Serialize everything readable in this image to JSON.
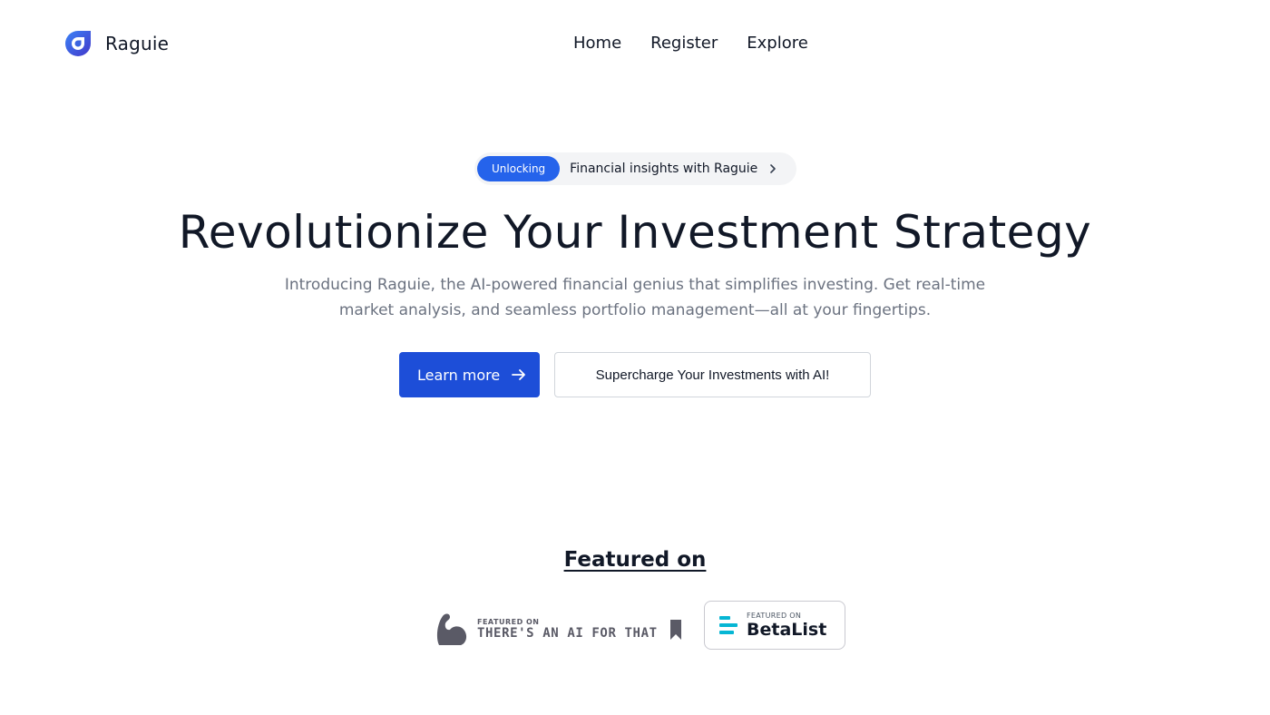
{
  "brand": {
    "name": "Raguie",
    "icon": "raguie-drop-logo",
    "color": "#2563eb"
  },
  "nav": {
    "items": [
      "Home",
      "Register",
      "Explore"
    ]
  },
  "announcement": {
    "badge": "Unlocking",
    "text": "Financial insights with Raguie",
    "icon": "chevron-right-icon"
  },
  "hero": {
    "title": "Revolutionize Your Investment Strategy",
    "subtitle": "Introducing Raguie, the AI-powered financial genius that simplifies investing. Get real-time market analysis, and seamless portfolio management—all at your fingertips.",
    "primary_button": "Learn more",
    "primary_icon": "arrow-right-icon",
    "secondary_button": "Supercharge Your Investments with AI!"
  },
  "featured": {
    "title": "Featured on",
    "theresanaiforthat": {
      "small": "FEATURED ON",
      "big": "THERE'S AN AI FOR THAT",
      "icon": "flexed-arm-icon",
      "bookmark_icon": "bookmark-icon"
    },
    "betalist": {
      "small": "FEATURED ON",
      "big": "BetaList",
      "icon": "betalist-bars-icon"
    }
  },
  "colors": {
    "accent": "#2563eb",
    "button": "#1d4ed8",
    "text": "#111827",
    "muted": "#6b7280"
  }
}
